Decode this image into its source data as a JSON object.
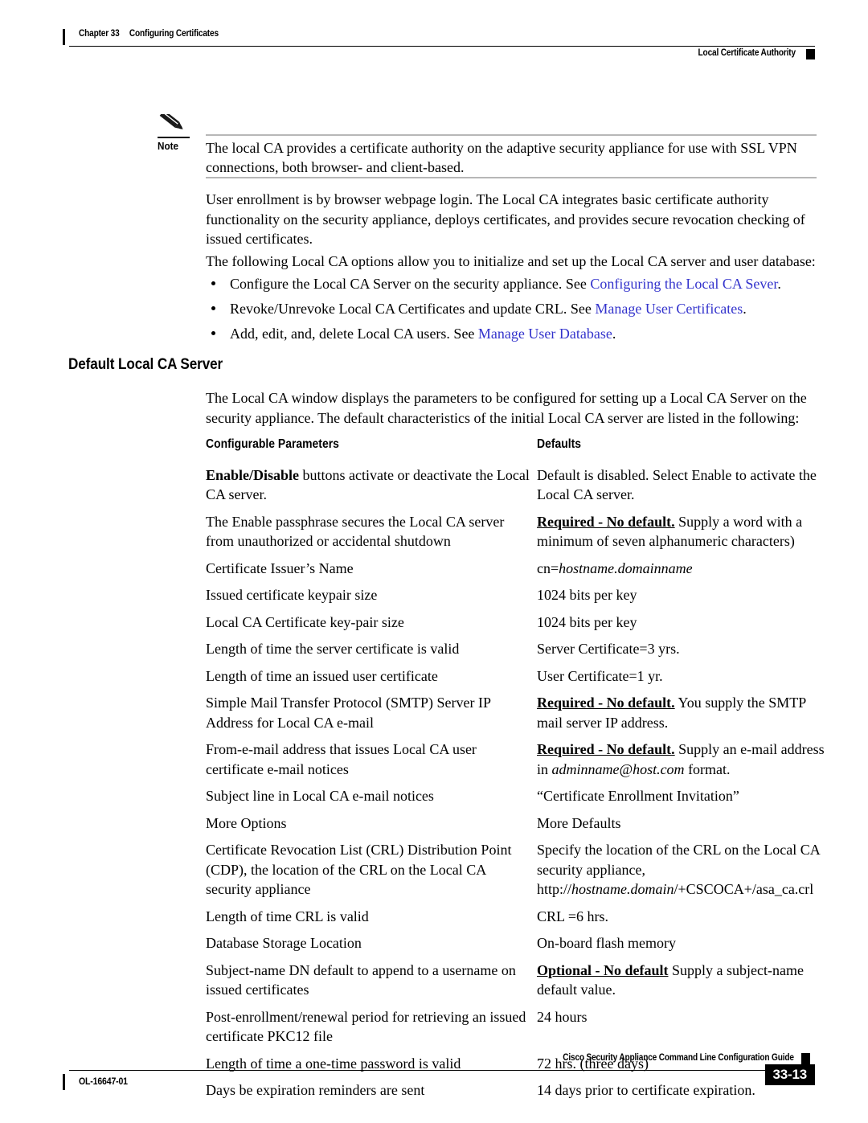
{
  "header": {
    "chapter": "Chapter 33",
    "chapter_title": "Configuring Certificates",
    "section": "Local Certificate Authority"
  },
  "note": {
    "label": "Note",
    "icon": "pencil-icon",
    "text": "The local CA provides a certificate authority on the adaptive security appliance for use with SSL VPN connections, both browser- and client-based."
  },
  "body": {
    "paragraph_1": "User enrollment is by browser webpage login. The Local CA integrates basic certificate authority functionality on the security appliance, deploys certificates, and provides secure revocation checking of issued certificates.",
    "paragraph_2": "The following Local CA options allow you to initialize and set up the Local CA server and user database:",
    "paragraph_3": "The Local CA window displays the parameters to be configured for setting up a Local CA Server on the security appliance. The default characteristics of the initial Local CA server are listed in the following:"
  },
  "bullets": [
    {
      "text_before": "Configure the Local CA Server on the security appliance. See ",
      "link": "Configuring the Local CA Sever",
      "text_after": "."
    },
    {
      "text_before": "Revoke/Unrevoke Local CA Certificates and update CRL. See ",
      "link": "Manage User Certificates",
      "text_after": "."
    },
    {
      "text_before": "Add, edit, and, delete Local CA users. See ",
      "link": "Manage User Database",
      "text_after": "."
    }
  ],
  "section_heading": "Default Local CA Server",
  "table": {
    "headers": {
      "col_a": "Configurable Parameters",
      "col_b": "Defaults"
    },
    "rows": [
      {
        "param_bold": "Enable/Disable",
        "param_rest": " buttons activate or deactivate the Local CA server.",
        "default_text": "Default is disabled. Select Enable to activate the Local CA server."
      },
      {
        "param_rest": "The Enable passphrase secures the Local CA server from unauthorized or accidental shutdown",
        "default_req": "Required - No default.",
        "default_text": " Supply a word with a minimum of seven alphanumeric characters)"
      },
      {
        "param_rest": "Certificate Issuer’s Name",
        "default_text": "cn=",
        "default_italic": "hostname.domainname"
      },
      {
        "param_rest": "Issued certificate keypair size",
        "default_text": "1024 bits per key"
      },
      {
        "param_rest": "Local CA Certificate key-pair size",
        "default_text": "1024 bits per key"
      },
      {
        "param_rest": "Length of time the server certificate is valid",
        "default_text": "Server Certificate=3 yrs."
      },
      {
        "param_rest": "Length of time an issued user certificate",
        "default_text": "User Certificate=1 yr."
      },
      {
        "param_rest": "Simple Mail Transfer Protocol (SMTP) Server IP Address for Local CA e-mail",
        "default_req": "Required - No default.",
        "default_text": " You supply the SMTP mail server IP address."
      },
      {
        "param_rest": "From-e-mail address that issues Local CA user certificate e-mail notices",
        "default_req": "Required - No default.",
        "default_text": " Supply an e-mail address in ",
        "default_italic": "adminname@host.com",
        "default_tail": " format."
      },
      {
        "param_rest": "Subject line in Local CA e-mail notices",
        "default_text": "“Certificate Enrollment Invitation”"
      },
      {
        "param_rest": "More Options",
        "default_text": "More Defaults"
      },
      {
        "param_rest": "Certificate Revocation List (CRL) Distribution Point (CDP), the location of the CRL on the Local CA security appliance",
        "default_text": "Specify the location of the CRL on the Local CA security appliance, http://",
        "default_italic": "hostname.domain",
        "default_tail": "/+CSCOCA+/asa_ca.crl"
      },
      {
        "param_rest": "Length of time CRL is valid",
        "default_text": "CRL =6 hrs."
      },
      {
        "param_rest": "Database Storage Location",
        "default_text": "On-board flash memory"
      },
      {
        "param_rest": "Subject-name DN default to append to a username on issued certificates",
        "default_req": "Optional - No default",
        "default_text": " Supply a subject-name default value."
      },
      {
        "param_rest": "Post-enrollment/renewal period for retrieving an issued certificate PKC12 file",
        "default_text": "24 hours"
      },
      {
        "param_rest": "Length of time a one-time password is valid",
        "default_text": "72 hrs. (three days)"
      },
      {
        "param_rest": "Days be expiration reminders are sent",
        "default_text": "14 days prior to certificate expiration."
      }
    ]
  },
  "footer": {
    "doc_id": "OL-16647-01",
    "guide_title": "Cisco Security Appliance Command Line Configuration Guide",
    "page_number": "33-13"
  },
  "colors": {
    "link": "#3333cc",
    "text": "#000000",
    "rule": "#b7b7b7"
  }
}
